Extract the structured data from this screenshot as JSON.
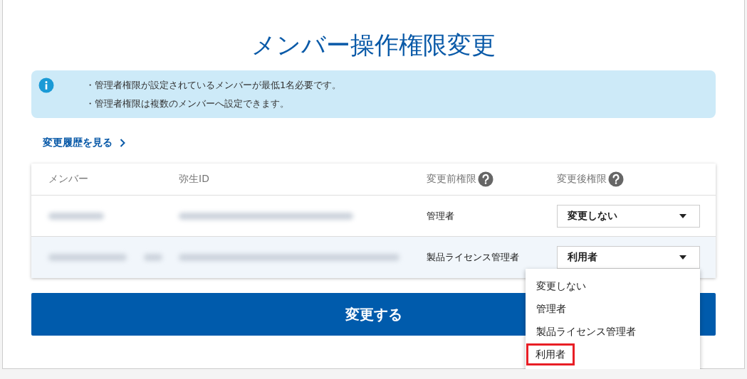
{
  "title": "メンバー操作権限変更",
  "notices": [
    "・管理者権限が設定されているメンバーが最低1名必要です。",
    "・管理者権限は複数のメンバーへ設定できます。"
  ],
  "history_link": "変更履歴を見る",
  "table": {
    "columns": [
      {
        "label": "メンバー",
        "help": false
      },
      {
        "label": "弥生ID",
        "help": false
      },
      {
        "label": "変更前権限",
        "help": true
      },
      {
        "label": "変更後権限",
        "help": true
      }
    ],
    "rows": [
      {
        "before": "管理者",
        "after": "変更しない",
        "highlighted": false,
        "open": false
      },
      {
        "before": "製品ライセンス管理者",
        "after": "利用者",
        "highlighted": true,
        "open": true
      }
    ]
  },
  "dropdown_options": [
    {
      "label": "変更しない",
      "selected": false
    },
    {
      "label": "管理者",
      "selected": false
    },
    {
      "label": "製品ライセンス管理者",
      "selected": false
    },
    {
      "label": "利用者",
      "selected": true
    }
  ],
  "submit_button": "変更する"
}
